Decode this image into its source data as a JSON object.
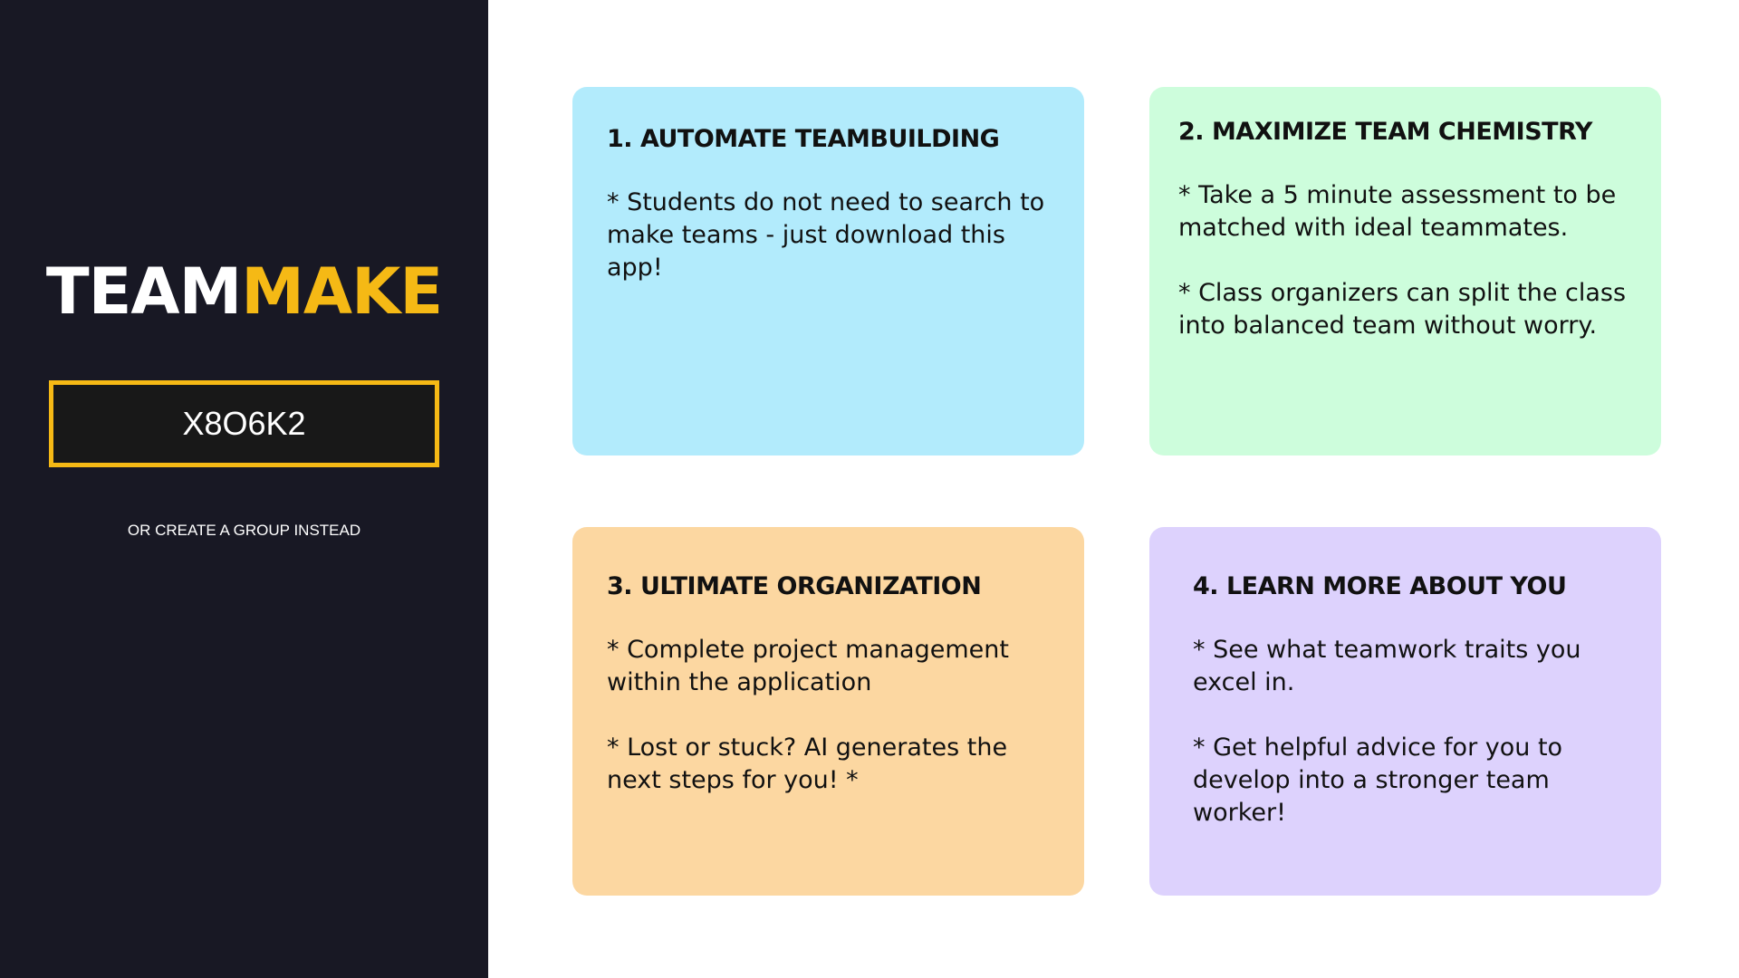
{
  "sidebar": {
    "logo_part1": "TEAM",
    "logo_part2": "MAKE",
    "group_code": "X8O6K2",
    "create_group_link": "OR CREATE A GROUP INSTEAD"
  },
  "cards": [
    {
      "title": "1. AUTOMATE TEAMBUILDING",
      "points": [
        "* Students do not need to search to make teams - just download this app!"
      ]
    },
    {
      "title": "2. MAXIMIZE TEAM CHEMISTRY",
      "points": [
        "* Take a 5 minute assessment to be matched with ideal teammates.",
        "* Class organizers can split the class into balanced team without worry."
      ]
    },
    {
      "title": "3. ULTIMATE ORGANIZATION",
      "points": [
        "* Complete project management within the application",
        "* Lost or stuck? AI generates the next steps for you! *"
      ]
    },
    {
      "title": "4. LEARN MORE ABOUT YOU",
      "points": [
        "* See what teamwork traits you excel in.",
        "* Get helpful advice for you to develop into a stronger team worker!"
      ]
    }
  ],
  "colors": {
    "sidebar_bg": "#181824",
    "accent": "#f5b915",
    "card_1": "#b2ebfc",
    "card_2": "#cdfddc",
    "card_3": "#fcd7a1",
    "card_4": "#ddd2fd"
  }
}
